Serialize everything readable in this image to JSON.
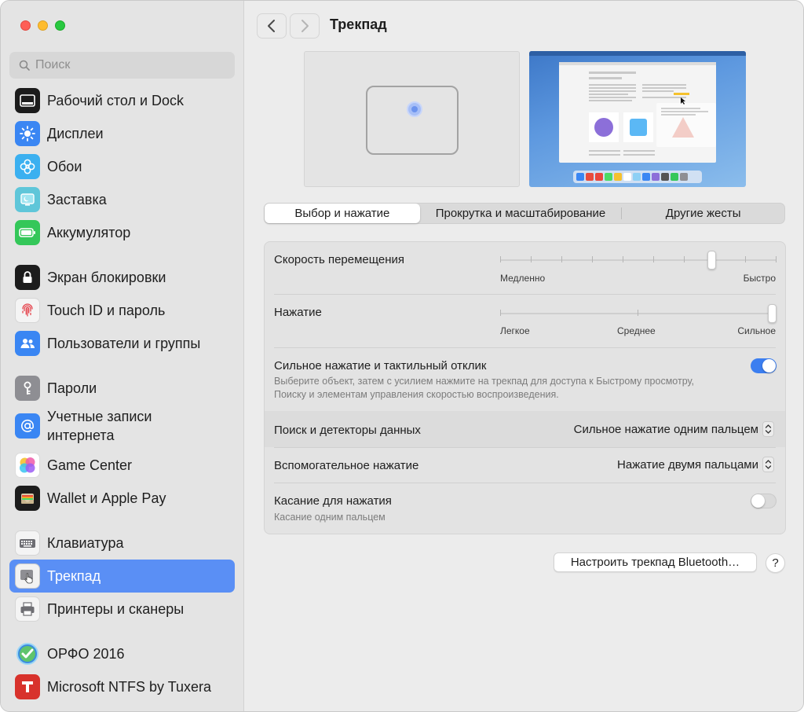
{
  "window": {
    "title": "Трекпад"
  },
  "search": {
    "placeholder": "Поиск"
  },
  "sidebar": {
    "items": [
      {
        "label": "Рабочий стол и Dock",
        "icon": "desktop-dock-icon"
      },
      {
        "label": "Дисплеи",
        "icon": "display-icon"
      },
      {
        "label": "Обои",
        "icon": "wallpaper-icon"
      },
      {
        "label": "Заставка",
        "icon": "screensaver-icon"
      },
      {
        "label": "Аккумулятор",
        "icon": "battery-icon"
      },
      {
        "label": "Экран блокировки",
        "icon": "lock-screen-icon"
      },
      {
        "label": "Touch ID и пароль",
        "icon": "fingerprint-icon"
      },
      {
        "label": "Пользователи и группы",
        "icon": "users-icon"
      },
      {
        "label": "Пароли",
        "icon": "key-icon"
      },
      {
        "label": "Учетные записи интернета",
        "icon": "at-icon"
      },
      {
        "label": "Game Center",
        "icon": "game-center-icon"
      },
      {
        "label": "Wallet и Apple Pay",
        "icon": "wallet-icon"
      },
      {
        "label": "Клавиатура",
        "icon": "keyboard-icon"
      },
      {
        "label": "Трекпад",
        "icon": "trackpad-icon",
        "active": true
      },
      {
        "label": "Принтеры и сканеры",
        "icon": "printer-icon"
      },
      {
        "label": "ОРФО 2016",
        "icon": "orfo-icon"
      },
      {
        "label": "Microsoft NTFS by Tuxera",
        "icon": "tuxera-icon"
      }
    ]
  },
  "tabs": [
    {
      "label": "Выбор и нажатие",
      "active": true
    },
    {
      "label": "Прокрутка и масштабирование"
    },
    {
      "label": "Другие жесты"
    }
  ],
  "settings": {
    "tracking_speed": {
      "label": "Скорость перемещения",
      "min_label": "Медленно",
      "max_label": "Быстро",
      "ticks": 10,
      "value_fraction": 0.77
    },
    "click": {
      "label": "Нажатие",
      "labels": [
        "Легкое",
        "Среднее",
        "Сильное"
      ],
      "value_fraction": 1.0
    },
    "force_click": {
      "label": "Сильное нажатие и тактильный отклик",
      "description": "Выберите объект, затем с усилием нажмите на трекпад для доступа к Быстрому просмотру, Поиску и элементам управления скоростью воспроизведения.",
      "enabled": true
    },
    "lookup": {
      "label": "Поиск и детекторы данных",
      "value": "Сильное нажатие одним пальцем"
    },
    "secondary_click": {
      "label": "Вспомогательное нажатие",
      "value": "Нажатие двумя пальцами"
    },
    "tap_to_click": {
      "label": "Касание для нажатия",
      "sub": "Касание одним пальцем",
      "enabled": false
    }
  },
  "buttons": {
    "bluetooth_setup": "Настроить трекпад Bluetooth…",
    "help": "?"
  },
  "colors": {
    "accent": "#3b7ef0",
    "sidebar_active": "#5a8ff5"
  }
}
